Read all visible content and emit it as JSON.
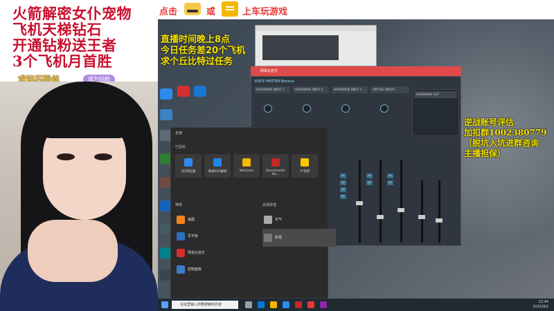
{
  "stream": {
    "promo_lines": [
      "火箭解密女仆宠物",
      "飞机天梯钻石",
      "开通钻粉送王者",
      "3个飞机月首胜"
    ],
    "gold_text": "求钻石粉丝",
    "gold_button": "成为钻粉"
  },
  "top_bar": {
    "click_label": "点击",
    "or_label": "或",
    "play_label": "上车玩游戏"
  },
  "screen_overlay": {
    "lines": [
      "直播时间晚上8点",
      "今日任务差20个飞机",
      "求个丘比特过任务"
    ]
  },
  "right_overlay": {
    "lines": [
      "逆战账号评估",
      "加扣群1002380779",
      "（脱坑入坑进群咨询",
      "主播担保）"
    ]
  },
  "start_menu": {
    "header": "全部",
    "pinned_label": "已固定",
    "pinned": [
      {
        "label": "QQ浏览器",
        "color": "#2d8cf0"
      },
      {
        "label": "来通SEA截屏",
        "color": "#1e88e5"
      },
      {
        "label": "WeGame",
        "color": "#f6b800"
      },
      {
        "label": "Voicemeeter Ba...",
        "color": "#c62828"
      },
      {
        "label": "YY语音",
        "color": "#f9c600"
      }
    ],
    "recommended_label": "推荐",
    "recent_label": "资源管理",
    "list_items": [
      {
        "label": "画图",
        "color": "#f58220"
      },
      {
        "label": "写字板",
        "color": "#2d6fbf"
      },
      {
        "label": "网易云音乐",
        "color": "#d32f2f"
      },
      {
        "label": "控制面板",
        "color": "#3d7cc9"
      }
    ],
    "right_items": [
      {
        "label": "天气",
        "color": "#aaaaaa"
      },
      {
        "label": "影视",
        "color": "#777777"
      }
    ]
  },
  "taskbar": {
    "search_placeholder": "在这里输入你要搜索的内容",
    "time": "22:44",
    "date": "2021/9/2"
  },
  "voicemeeter": {
    "title": "网易云音乐",
    "brand": "VOICE MEETER Banana",
    "inputs": [
      "HARDWARE INPUT 1",
      "HARDWARE INPUT 2",
      "HARDWARE INPUT 3",
      "VIRTUAL INPUTS"
    ],
    "hw_out": "HARDWARE OUT"
  }
}
